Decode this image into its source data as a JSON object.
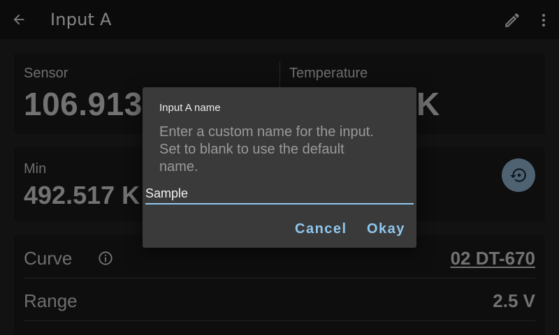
{
  "appbar": {
    "title": "Input A",
    "back_icon": "arrow-left-icon",
    "edit_icon": "pencil-icon",
    "more_icon": "more-vert-icon"
  },
  "reading": {
    "sensor_label": "Sensor",
    "sensor_value": "106.913",
    "temperature_label": "Temperature",
    "temperature_value": "K"
  },
  "minmax": {
    "min_label": "Min",
    "min_value": "492.517 K",
    "reset_icon": "reset-history-icon"
  },
  "settings": {
    "curve_label": "Curve",
    "curve_value": "02 DT-670",
    "range_label": "Range",
    "range_value": "2.5 V"
  },
  "dialog": {
    "title": "Input A name",
    "message": "Enter a custom name for the input. Set to blank to use the default name.",
    "input_value": "Sample",
    "cancel_label": "Cancel",
    "okay_label": "Okay"
  },
  "colors": {
    "accent": "#8fc7ee",
    "reset_button": "#8fb3cf",
    "app_bar": "#141414",
    "card": "#1a1a1a",
    "dialog": "#3a3a3a"
  }
}
